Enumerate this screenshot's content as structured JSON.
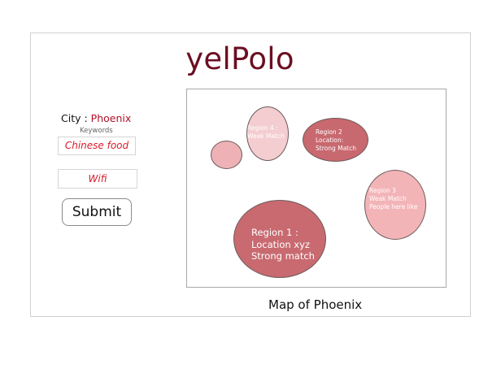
{
  "app": {
    "title": "yelPolo"
  },
  "search": {
    "city_label": "City :",
    "city_value": "Phoenix",
    "keywords_label": "Keywords",
    "keywords": [
      "Chinese food",
      "Wifi"
    ],
    "submit_label": "Submit"
  },
  "map": {
    "caption": "Map of Phoenix",
    "regions": [
      {
        "text": "Region 4 :\nWeak Match",
        "fill": "#f3cdd0"
      },
      {
        "text": "Region 2\nLocation:\nStrong Match",
        "fill": "#c8686f"
      },
      {
        "text": "",
        "fill": "#eeb2b6"
      },
      {
        "text": "Region 3\nWeak Match\nPeople here like",
        "fill": "#f3b4b8"
      },
      {
        "text": "Region 1 :\nLocation xyz\nStrong match",
        "fill": "#c86a70"
      }
    ]
  },
  "colors": {
    "title": "#6b0f22",
    "city_value": "#b0102a",
    "keyword_text": "#d81d2b"
  }
}
